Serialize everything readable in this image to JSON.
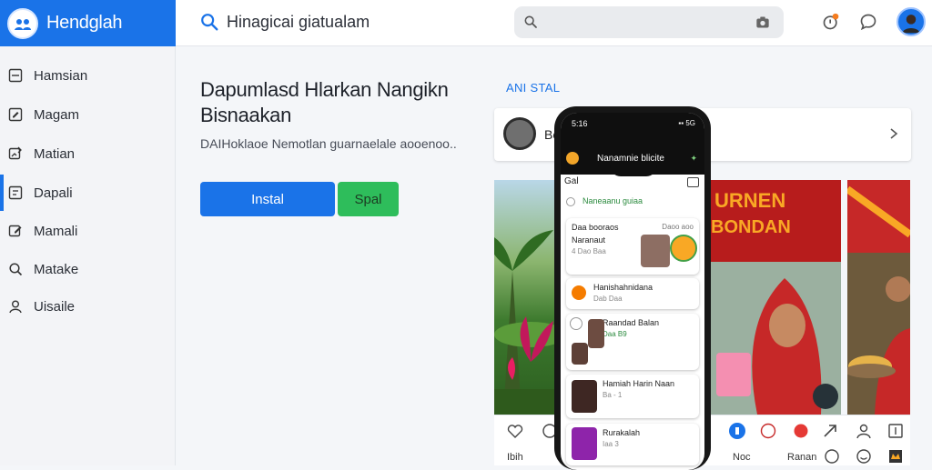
{
  "brand": {
    "name": "Hendglah"
  },
  "header": {
    "title": "Hinagicai giatualam",
    "search_placeholder": ""
  },
  "sidebar": {
    "items": [
      {
        "label": "Hamsian",
        "active": false
      },
      {
        "label": "Magam",
        "active": false
      },
      {
        "label": "Matian",
        "active": false
      },
      {
        "label": "Dapali",
        "active": true
      },
      {
        "label": "Mamali",
        "active": false
      },
      {
        "label": "Matake",
        "active": false
      },
      {
        "label": "Uisaile",
        "active": false
      }
    ]
  },
  "hero": {
    "title": "Dapumlasd Hlarkan Nangikn Bisnaakan",
    "subtitle": "DAIHoklaoe Nemotlan guarnaelale aooenoo..",
    "install_label": "Instal",
    "share_label": "Spal"
  },
  "preview": {
    "section_label": "ANI STAL",
    "profile_name": "Be"
  },
  "phone": {
    "time": "5:16",
    "signal": "▪▪ 5G",
    "app_name": "Nanamnie blicite",
    "head": "Gal",
    "trend": "Naneaanu guiaa",
    "cards": [
      {
        "title": "Daa booraos",
        "meta_right": "Daoo aoo",
        "line2": "Naranaut",
        "meta": "4 Dao Baa"
      },
      {
        "title": "Hanishahnidana",
        "meta": "Dab Daa"
      },
      {
        "title": "Raandad Balan",
        "meta": "Daa B9"
      },
      {
        "title": "Hamiah Harin Naan",
        "meta": "Ba - 1"
      },
      {
        "title": "Rurakalah",
        "meta": "Iaa 3"
      }
    ]
  },
  "bottom_bar": {
    "left_label": "Ibih",
    "mid_label": "Noc",
    "right_label": "Ranan"
  },
  "colors": {
    "accent": "#1a73e8",
    "share": "#2ebd5b"
  }
}
